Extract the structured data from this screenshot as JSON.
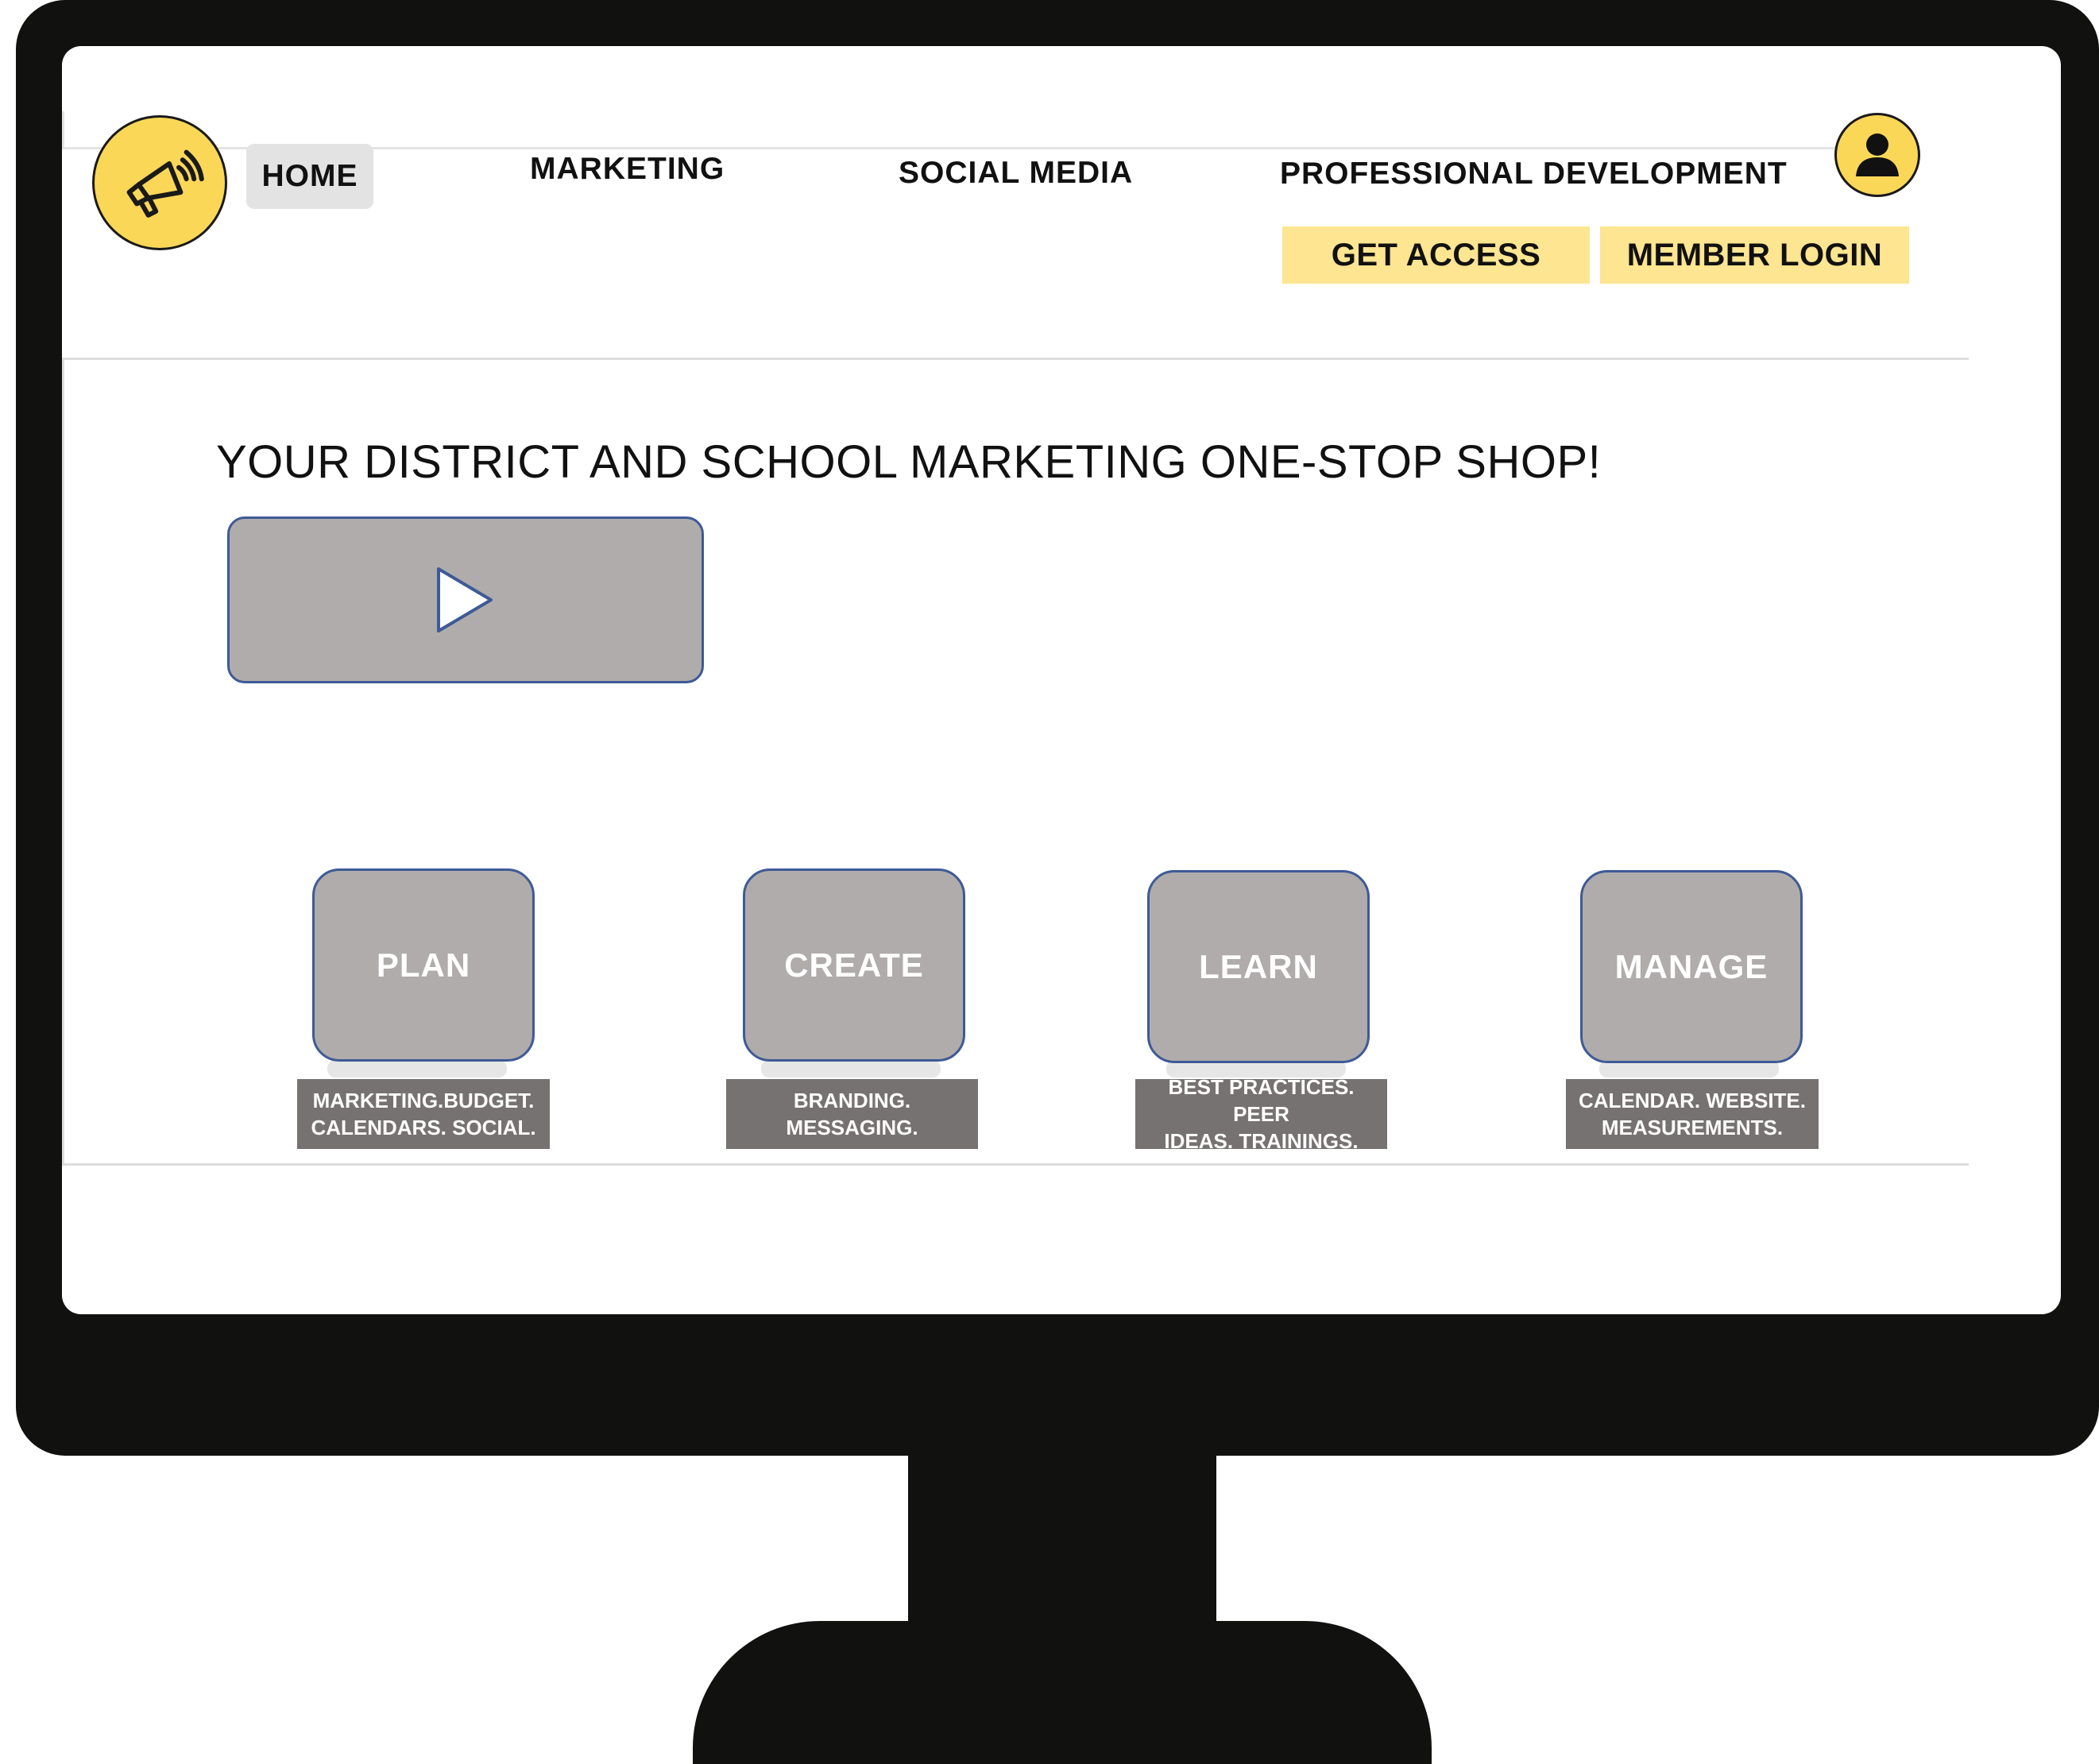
{
  "nav": {
    "home": "HOME",
    "marketing": "MARKETING",
    "social_media": "SOCIAL MEDIA",
    "professional_development": "PROFESSIONAL DEVELOPMENT"
  },
  "actions": {
    "get_access": "GET ACCESS",
    "member_login": "MEMBER LOGIN"
  },
  "hero": {
    "title": "YOUR DISTRICT AND SCHOOL MARKETING ONE-STOP SHOP!"
  },
  "tiles": [
    {
      "label": "PLAN",
      "caption_line1": "MARKETING.BUDGET.",
      "caption_line2": "CALENDARS. SOCIAL."
    },
    {
      "label": "CREATE",
      "caption_line1": "BRANDING.",
      "caption_line2": "MESSAGING."
    },
    {
      "label": "LEARN",
      "caption_line1": "BEST PRACTICES. PEER",
      "caption_line2": "IDEAS. TRAININGS."
    },
    {
      "label": "MANAGE",
      "caption_line1": "CALENDAR. WEBSITE.",
      "caption_line2": "MEASUREMENTS."
    }
  ],
  "icons": {
    "logo": "megaphone-icon",
    "user": "user-icon",
    "video": "play-icon"
  },
  "colors": {
    "accent_yellow": "#fbd758",
    "button_yellow": "#fde591",
    "tile_gray": "#afacab",
    "caption_gray": "#767271",
    "tile_border": "#3e5a96",
    "monitor": "#111110"
  }
}
